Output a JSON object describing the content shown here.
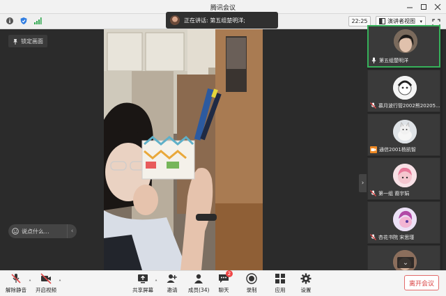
{
  "window": {
    "title": "腾讯会议"
  },
  "topbar": {
    "clock": "22:25",
    "view_label": "演讲者视图"
  },
  "speaking": {
    "text": "正在讲话: 第五组楚明洋;"
  },
  "stage": {
    "lock_label": "锁定画面",
    "chat_placeholder": "说点什么..."
  },
  "participants": [
    {
      "name": "第五组楚明洋",
      "avatar": "speaker-avatar",
      "active": true
    },
    {
      "name": "慕月波行管2002熊20205...",
      "avatar": "cartoon-avatar"
    },
    {
      "name": "通信2001杨凯智",
      "avatar": "cat-avatar"
    },
    {
      "name": "第一组 裔宇娟",
      "avatar": "pink-cartoon-avatar"
    },
    {
      "name": "杏花书院 宋思瑾",
      "avatar": "pony-avatar"
    }
  ],
  "toolbar": {
    "mute_label": "解除静音",
    "video_label": "开启视频",
    "share_label": "共享屏幕",
    "invite_label": "邀请",
    "members_label": "成员(34)",
    "chat_label": "聊天",
    "chat_badge": "2",
    "record_label": "录制",
    "apps_label": "应用",
    "settings_label": "设置",
    "leave_label": "离开会议"
  },
  "colors": {
    "active_border": "#36b15a",
    "leave_red": "#d94040",
    "mute_red": "#e04a4a"
  }
}
